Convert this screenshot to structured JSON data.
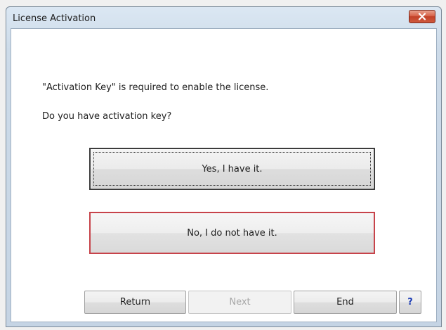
{
  "window": {
    "title": "License Activation"
  },
  "message": {
    "line1": "\"Activation Key\" is required to enable the license.",
    "line2": "Do you have activation key?"
  },
  "choices": {
    "yes_label": "Yes, I have it.",
    "no_label": "No, I do not have it."
  },
  "footer": {
    "return_label": "Return",
    "next_label": "Next",
    "end_label": "End",
    "help_label": "?"
  },
  "colors": {
    "close_button": "#c24128",
    "no_button_border": "#c7434a",
    "help_text": "#1f3fb5"
  },
  "icons": {
    "close": "close-icon"
  }
}
